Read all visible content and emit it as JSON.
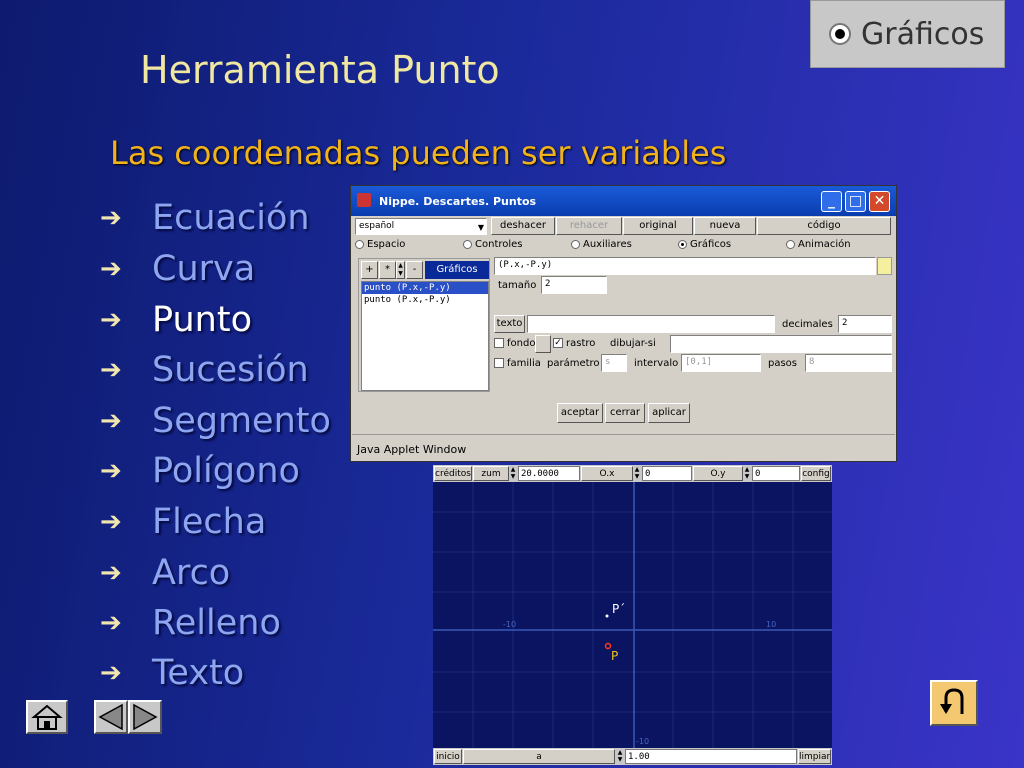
{
  "badge": {
    "label": "Gráficos"
  },
  "title": "Herramienta Punto",
  "subtitle": "Las coordenadas pueden ser variables",
  "menu": [
    {
      "label": "Ecuación",
      "active": false
    },
    {
      "label": "Curva",
      "active": false
    },
    {
      "label": "Punto",
      "active": true
    },
    {
      "label": "Sucesión",
      "active": false
    },
    {
      "label": "Segmento",
      "active": false
    },
    {
      "label": "Polígono",
      "active": false
    },
    {
      "label": "Flecha",
      "active": false
    },
    {
      "label": "Arco",
      "active": false
    },
    {
      "label": "Relleno",
      "active": false
    },
    {
      "label": "Texto",
      "active": false
    }
  ],
  "applet": {
    "title": "Nippe. Descartes. Puntos",
    "language": "español",
    "toolbar": [
      "deshacer",
      "rehacer",
      "original",
      "nueva",
      "código"
    ],
    "tabs": [
      "Espacio",
      "Controles",
      "Auxiliares",
      "Gráficos",
      "Animación"
    ],
    "selected_tab": "Gráficos",
    "list_buttons": [
      "+",
      "*",
      "-"
    ],
    "list_header": "Gráficos",
    "list_items": [
      "punto (P.x,-P.y)",
      "punto (P.x,-P.y)"
    ],
    "expression": "(P.x,-P.y)",
    "tamano_label": "tamaño",
    "tamano_value": "2",
    "texto_button": "texto",
    "decimales_label": "decimales",
    "decimales_value": "2",
    "fondo_label": "fondo",
    "rastro_label": "rastro",
    "dibujar_label": "dibujar-si",
    "familia_label": "familia",
    "parametro_label": "parámetro",
    "parametro_value": "s",
    "intervalo_label": "intervalo",
    "intervalo_value": "[0,1]",
    "pasos_label": "pasos",
    "pasos_value": "8",
    "actions": [
      "aceptar",
      "cerrar",
      "aplicar"
    ],
    "status": "Java Applet Window"
  },
  "graph": {
    "creditos": "créditos",
    "zum_label": "zum",
    "zum_value": "20.0000",
    "ox_label": "O.x",
    "ox_value": "0",
    "oy_label": "O.y",
    "oy_value": "0",
    "config": "config",
    "inicio": "inicio",
    "a_label": "a",
    "a_value": "1.00",
    "limpiar": "limpiar",
    "tick_neg": "-10",
    "tick_pos": "10",
    "tick_bottom": "-10",
    "point_p": "P",
    "point_p_prime": "P´"
  },
  "colors": {
    "accent": "#f2b21a",
    "title": "#f0e8a0",
    "menu": "#8ea6f0"
  },
  "icons": [
    "home-icon",
    "prev-arrow-icon",
    "next-arrow-icon",
    "return-icon"
  ]
}
